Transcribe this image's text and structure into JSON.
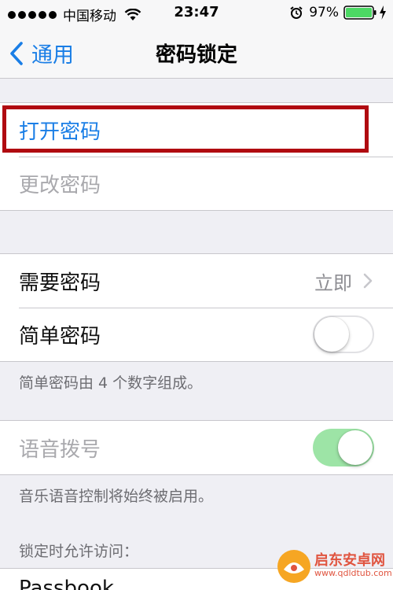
{
  "status_bar": {
    "carrier": "中国移动",
    "time": "23:47",
    "battery_percent": "97%",
    "signal_dots": 5,
    "icons": [
      "signal-dots-icon",
      "wifi-icon",
      "alarm-icon",
      "battery-icon",
      "charging-bolt-icon"
    ]
  },
  "nav": {
    "back_label": "通用",
    "title": "密码锁定"
  },
  "group_passcode": {
    "turn_on": "打开密码",
    "change": "更改密码"
  },
  "group_require": {
    "require_label": "需要密码",
    "require_value": "立即",
    "simple_label": "简单密码",
    "simple_enabled": false,
    "simple_footnote": "简单密码由 4 个数字组成。"
  },
  "group_voice": {
    "voice_dial_label": "语音拨号",
    "voice_dial_enabled": true,
    "voice_footnote": "音乐语音控制将始终被启用。"
  },
  "locked_access": {
    "header": "锁定时允许访问：",
    "partial_row": "Passbook"
  },
  "watermark": {
    "title": "启东安卓网",
    "url": "www.qdldtub.com"
  },
  "colors": {
    "accent": "#1a7ee6",
    "highlight_border": "#b00a10",
    "toggle_on": "#9de4a6",
    "background": "#efeff4"
  }
}
